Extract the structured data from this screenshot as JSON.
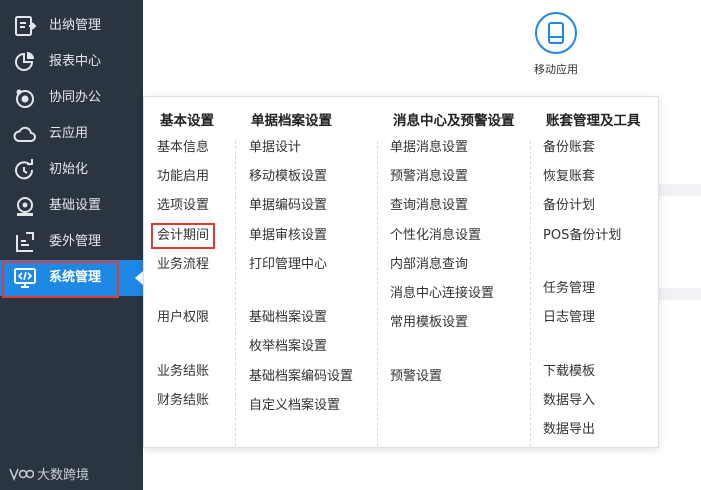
{
  "sidebar": {
    "items": [
      {
        "label": "出纳管理",
        "icon": "cashier-icon"
      },
      {
        "label": "报表中心",
        "icon": "report-pie-icon"
      },
      {
        "label": "协同办公",
        "icon": "collaboration-icon"
      },
      {
        "label": "云应用",
        "icon": "cloud-icon"
      },
      {
        "label": "初始化",
        "icon": "initialize-icon"
      },
      {
        "label": "基础设置",
        "icon": "settings-icon"
      },
      {
        "label": "委外管理",
        "icon": "outsourcing-icon"
      },
      {
        "label": "系统管理",
        "icon": "code-monitor-icon",
        "active": true
      }
    ],
    "brand": "大数跨境"
  },
  "app_tiles": {
    "mobile": {
      "label": "移动应用",
      "icon": "mobile-app-icon"
    }
  },
  "menu": {
    "columns": [
      {
        "title": "基本设置",
        "items": [
          "基本信息",
          "功能启用",
          "选项设置",
          "会计期间",
          "业务流程",
          "用户权限",
          "业务结账",
          "财务结账"
        ]
      },
      {
        "title": "单据档案设置",
        "items": [
          "单据设计",
          "移动模板设置",
          "单据编码设置",
          "单据审核设置",
          "打印管理中心",
          "基础档案设置",
          "枚举档案设置",
          "基础档案编码设置",
          "自定义档案设置"
        ]
      },
      {
        "title": "消息中心及预警设置",
        "items": [
          "单据消息设置",
          "预警消息设置",
          "查询消息设置",
          "个性化消息设置",
          "内部消息查询",
          "消息中心连接设置",
          "常用模板设置",
          "预警设置"
        ]
      },
      {
        "title": "账套管理及工具",
        "items": [
          "备份账套",
          "恢复账套",
          "备份计划",
          "POS备份计划",
          "任务管理",
          "日志管理",
          "下载模板",
          "数据导入",
          "数据导出"
        ]
      }
    ],
    "highlighted_item": "会计期间"
  },
  "colors": {
    "sidebar_bg": "#2b3542",
    "active_bg": "#1e88e5",
    "highlight_border": "#e53935"
  }
}
